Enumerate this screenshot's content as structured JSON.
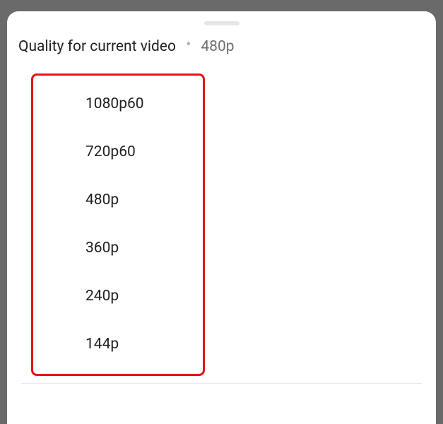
{
  "header": {
    "title": "Quality for current video",
    "current_value": "480p"
  },
  "quality_options": [
    {
      "label": "1080p60"
    },
    {
      "label": "720p60"
    },
    {
      "label": "480p"
    },
    {
      "label": "360p"
    },
    {
      "label": "240p"
    },
    {
      "label": "144p"
    }
  ]
}
